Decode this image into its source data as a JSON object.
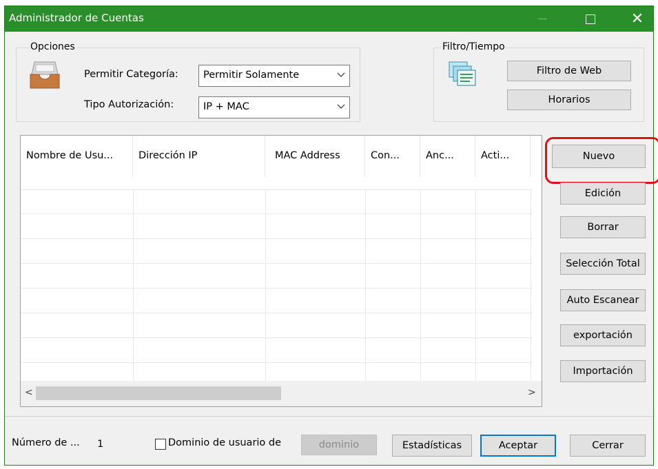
{
  "window": {
    "title": "Administrador de Cuentas"
  },
  "opciones": {
    "group_label": "Opciones",
    "permitir_categoria_label": "Permitir Categoría:",
    "permitir_categoria_value": "Permitir Solamente",
    "tipo_autorizacion_label": "Tipo Autorización:",
    "tipo_autorizacion_value": "IP + MAC"
  },
  "filtro": {
    "group_label": "Filtro/Tiempo",
    "filtro_web_label": "Filtro de Web",
    "horarios_label": "Horarios"
  },
  "table": {
    "columns": [
      "Nombre de Usu...",
      "Dirección IP",
      "MAC Address",
      "Con...",
      "Anc...",
      "Acti..."
    ],
    "rows": []
  },
  "side_buttons": {
    "nuevo": "Nuevo",
    "edicion": "Edición",
    "borrar": "Borrar",
    "seleccion_total": "Selección Total",
    "auto_escanear": "Auto Escanear",
    "exportacion": "exportación",
    "importacion": "Importación"
  },
  "footer": {
    "numero_label": "Número de ...",
    "numero_value": "1",
    "dominio_checkbox_label": "Dominio de usuario de",
    "dominio_button": "dominio",
    "estadisticas": "Estadísticas",
    "aceptar": "Aceptar",
    "cerrar": "Cerrar"
  },
  "colors": {
    "titlebar": "#2a8f2a",
    "highlight": "#e0101a",
    "primary_border": "#0078d7"
  }
}
